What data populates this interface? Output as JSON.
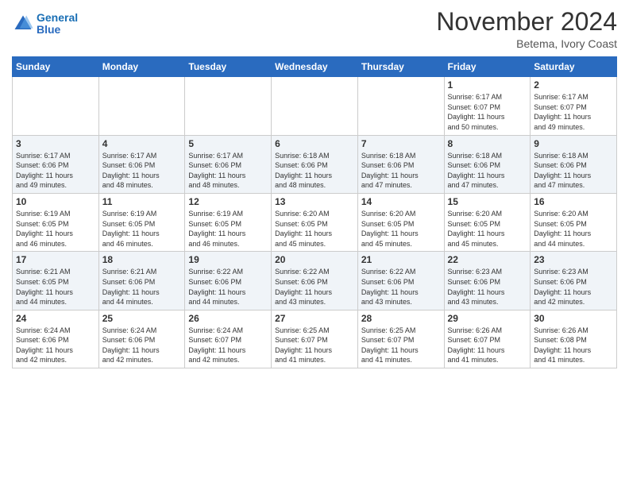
{
  "header": {
    "logo_line1": "General",
    "logo_line2": "Blue",
    "month": "November 2024",
    "location": "Betema, Ivory Coast"
  },
  "weekdays": [
    "Sunday",
    "Monday",
    "Tuesday",
    "Wednesday",
    "Thursday",
    "Friday",
    "Saturday"
  ],
  "rows": [
    [
      {
        "day": "",
        "info": ""
      },
      {
        "day": "",
        "info": ""
      },
      {
        "day": "",
        "info": ""
      },
      {
        "day": "",
        "info": ""
      },
      {
        "day": "",
        "info": ""
      },
      {
        "day": "1",
        "info": "Sunrise: 6:17 AM\nSunset: 6:07 PM\nDaylight: 11 hours\nand 50 minutes."
      },
      {
        "day": "2",
        "info": "Sunrise: 6:17 AM\nSunset: 6:07 PM\nDaylight: 11 hours\nand 49 minutes."
      }
    ],
    [
      {
        "day": "3",
        "info": "Sunrise: 6:17 AM\nSunset: 6:06 PM\nDaylight: 11 hours\nand 49 minutes."
      },
      {
        "day": "4",
        "info": "Sunrise: 6:17 AM\nSunset: 6:06 PM\nDaylight: 11 hours\nand 48 minutes."
      },
      {
        "day": "5",
        "info": "Sunrise: 6:17 AM\nSunset: 6:06 PM\nDaylight: 11 hours\nand 48 minutes."
      },
      {
        "day": "6",
        "info": "Sunrise: 6:18 AM\nSunset: 6:06 PM\nDaylight: 11 hours\nand 48 minutes."
      },
      {
        "day": "7",
        "info": "Sunrise: 6:18 AM\nSunset: 6:06 PM\nDaylight: 11 hours\nand 47 minutes."
      },
      {
        "day": "8",
        "info": "Sunrise: 6:18 AM\nSunset: 6:06 PM\nDaylight: 11 hours\nand 47 minutes."
      },
      {
        "day": "9",
        "info": "Sunrise: 6:18 AM\nSunset: 6:06 PM\nDaylight: 11 hours\nand 47 minutes."
      }
    ],
    [
      {
        "day": "10",
        "info": "Sunrise: 6:19 AM\nSunset: 6:05 PM\nDaylight: 11 hours\nand 46 minutes."
      },
      {
        "day": "11",
        "info": "Sunrise: 6:19 AM\nSunset: 6:05 PM\nDaylight: 11 hours\nand 46 minutes."
      },
      {
        "day": "12",
        "info": "Sunrise: 6:19 AM\nSunset: 6:05 PM\nDaylight: 11 hours\nand 46 minutes."
      },
      {
        "day": "13",
        "info": "Sunrise: 6:20 AM\nSunset: 6:05 PM\nDaylight: 11 hours\nand 45 minutes."
      },
      {
        "day": "14",
        "info": "Sunrise: 6:20 AM\nSunset: 6:05 PM\nDaylight: 11 hours\nand 45 minutes."
      },
      {
        "day": "15",
        "info": "Sunrise: 6:20 AM\nSunset: 6:05 PM\nDaylight: 11 hours\nand 45 minutes."
      },
      {
        "day": "16",
        "info": "Sunrise: 6:20 AM\nSunset: 6:05 PM\nDaylight: 11 hours\nand 44 minutes."
      }
    ],
    [
      {
        "day": "17",
        "info": "Sunrise: 6:21 AM\nSunset: 6:05 PM\nDaylight: 11 hours\nand 44 minutes."
      },
      {
        "day": "18",
        "info": "Sunrise: 6:21 AM\nSunset: 6:06 PM\nDaylight: 11 hours\nand 44 minutes."
      },
      {
        "day": "19",
        "info": "Sunrise: 6:22 AM\nSunset: 6:06 PM\nDaylight: 11 hours\nand 44 minutes."
      },
      {
        "day": "20",
        "info": "Sunrise: 6:22 AM\nSunset: 6:06 PM\nDaylight: 11 hours\nand 43 minutes."
      },
      {
        "day": "21",
        "info": "Sunrise: 6:22 AM\nSunset: 6:06 PM\nDaylight: 11 hours\nand 43 minutes."
      },
      {
        "day": "22",
        "info": "Sunrise: 6:23 AM\nSunset: 6:06 PM\nDaylight: 11 hours\nand 43 minutes."
      },
      {
        "day": "23",
        "info": "Sunrise: 6:23 AM\nSunset: 6:06 PM\nDaylight: 11 hours\nand 42 minutes."
      }
    ],
    [
      {
        "day": "24",
        "info": "Sunrise: 6:24 AM\nSunset: 6:06 PM\nDaylight: 11 hours\nand 42 minutes."
      },
      {
        "day": "25",
        "info": "Sunrise: 6:24 AM\nSunset: 6:06 PM\nDaylight: 11 hours\nand 42 minutes."
      },
      {
        "day": "26",
        "info": "Sunrise: 6:24 AM\nSunset: 6:07 PM\nDaylight: 11 hours\nand 42 minutes."
      },
      {
        "day": "27",
        "info": "Sunrise: 6:25 AM\nSunset: 6:07 PM\nDaylight: 11 hours\nand 41 minutes."
      },
      {
        "day": "28",
        "info": "Sunrise: 6:25 AM\nSunset: 6:07 PM\nDaylight: 11 hours\nand 41 minutes."
      },
      {
        "day": "29",
        "info": "Sunrise: 6:26 AM\nSunset: 6:07 PM\nDaylight: 11 hours\nand 41 minutes."
      },
      {
        "day": "30",
        "info": "Sunrise: 6:26 AM\nSunset: 6:08 PM\nDaylight: 11 hours\nand 41 minutes."
      }
    ]
  ]
}
